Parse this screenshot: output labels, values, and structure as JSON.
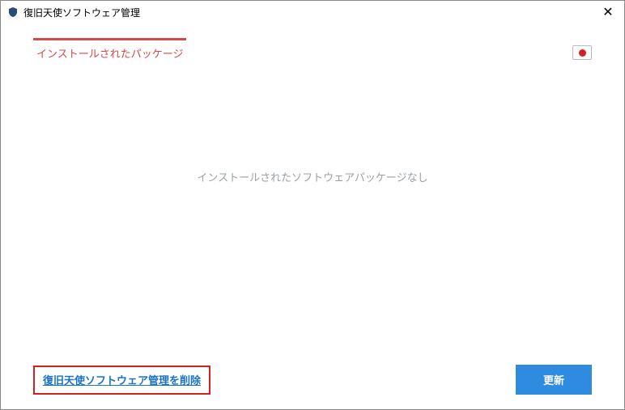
{
  "titlebar": {
    "title": "復旧天使ソフトウェア管理",
    "close_label": "✕"
  },
  "tab": {
    "installed_label": "インストールされたパッケージ"
  },
  "language": {
    "flag_name": "japan-flag"
  },
  "main": {
    "empty_message": "インストールされたソフトウェアパッケージなし"
  },
  "footer": {
    "delete_label": "復旧天使ソフトウェア管理を削除",
    "update_label": "更新"
  }
}
